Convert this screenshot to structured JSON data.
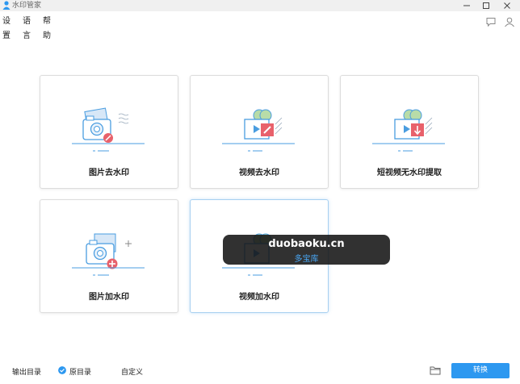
{
  "window": {
    "title": "水印管家"
  },
  "menu": [
    {
      "label": "设置"
    },
    {
      "label": "语言"
    },
    {
      "label": "帮助"
    }
  ],
  "cards": [
    {
      "label": "图片去水印"
    },
    {
      "label": "视频去水印"
    },
    {
      "label": "短视频无水印提取"
    },
    {
      "label": "图片加水印"
    },
    {
      "label": "视频加水印"
    }
  ],
  "watermark": {
    "line1": "duobaoku.cn",
    "line2": "多宝库"
  },
  "bottom": {
    "output_dir_label": "输出目录",
    "option_original": "原目录",
    "option_custom": "自定义",
    "convert_button": "转换"
  },
  "colors": {
    "accent": "#2d98f0",
    "badge_red": "#e8616b",
    "line_blue": "#4a9de0"
  }
}
